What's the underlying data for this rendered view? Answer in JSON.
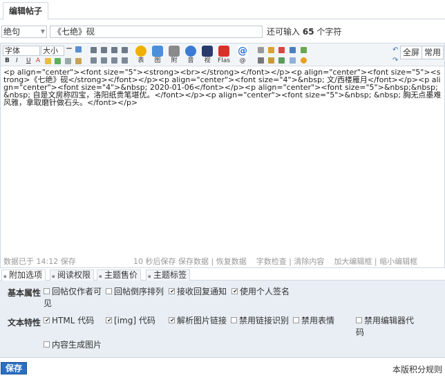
{
  "header": {
    "tab_label": "编辑帖子"
  },
  "subject": {
    "type_value": "绝句",
    "title_value": "《七绝》砚",
    "hint_prefix": "还可输入",
    "hint_count": "65",
    "hint_suffix": "个字符"
  },
  "toolbar": {
    "font_label": "字体",
    "size_label": "大小",
    "big_buttons": [
      {
        "label": "表",
        "color": "#f0b000"
      },
      {
        "label": "图",
        "color": "#4a90d9"
      },
      {
        "label": "附",
        "color": "#8a8a8a"
      },
      {
        "label": "音",
        "color": "#3a7bd5"
      },
      {
        "label": "视",
        "color": "#2a3b6b"
      },
      {
        "label": "Flas",
        "color": "#d9302a"
      },
      {
        "label": "@",
        "color": "#2a6fd5"
      }
    ],
    "fullscreen_label": "全屏",
    "common_label": "常用"
  },
  "editor": {
    "content": "<p align=\"center\"><font size=\"5\"><strong><br></strong></font></p><p align=\"center\"><font size=\"5\"><strong>《七绝》砚</strong></font></p><p align=\"center\"><font size=\"4\">&nbsp; 文/西楼雁月</font></p><p align=\"center\"><font size=\"4\">&nbsp; 2020-01-06</font></p><p align=\"center\"><font size=\"5\">&nbsp;&nbsp;&nbsp; 自是文房称四宝，洛阳纸贵笔堪优。</font></p><p align=\"center\"><font size=\"5\">&nbsp; &nbsp; 胸无点墨难风雅，拿取磨针做石头。</font></p>"
  },
  "statusbar": {
    "saved_text": "数据已于 14:12 保存",
    "autosave_text": "10 秒后保存",
    "save_data": "保存数据",
    "restore_data": "恢复数据",
    "word_check": "字数检查",
    "clear_content": "清除内容",
    "enlarge": "加大编辑框",
    "shrink": "缩小编辑框"
  },
  "options": {
    "tabs": [
      {
        "label": "附加选项"
      },
      {
        "label": "阅读权限"
      },
      {
        "label": "主题售价"
      },
      {
        "label": "主题标签"
      }
    ],
    "basic_label": "基本属性",
    "basic": [
      {
        "label": "回帖仅作者可见",
        "checked": false
      },
      {
        "label": "回帖倒序排列",
        "checked": false
      },
      {
        "label": "接收回复通知",
        "checked": true
      },
      {
        "label": "使用个人签名",
        "checked": true
      }
    ],
    "text_label": "文本特性",
    "text": [
      {
        "label": "HTML 代码",
        "checked": true
      },
      {
        "label": "[img] 代码",
        "checked": true
      },
      {
        "label": "解析图片链接",
        "checked": true
      },
      {
        "label": "禁用链接识别",
        "checked": false
      },
      {
        "label": "禁用表情",
        "checked": false
      },
      {
        "label": "禁用编辑器代码",
        "checked": false
      },
      {
        "label": "内容生成图片",
        "checked": false
      }
    ]
  },
  "footer": {
    "save_label": "保存",
    "rules_label": "本版积分规则"
  }
}
